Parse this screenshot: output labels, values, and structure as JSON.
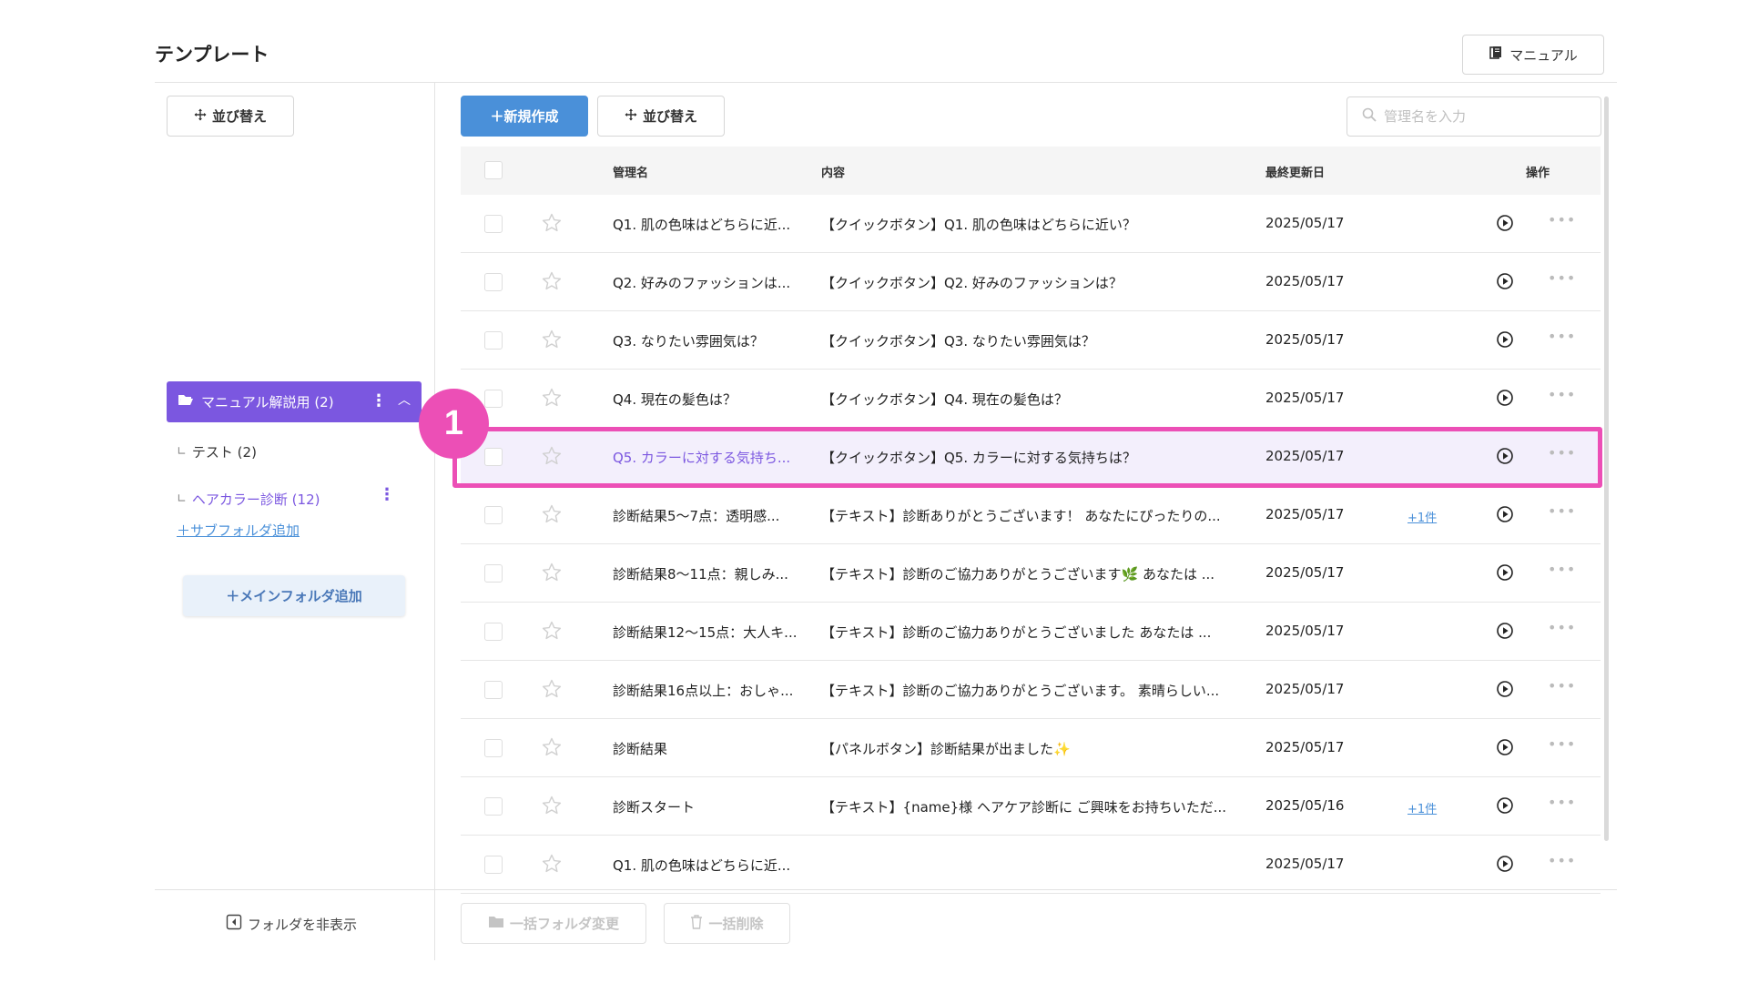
{
  "header": {
    "title": "テンプレート",
    "manual_label": "マニュアル"
  },
  "sidebar": {
    "sort_label": "並び替え",
    "main_folder": {
      "label": "マニュアル解説用 (2)"
    },
    "subfolders": [
      {
        "prefix": "∟",
        "label": "テスト (2)"
      },
      {
        "prefix": "∟",
        "label": "ヘアカラー診断 (12)"
      }
    ],
    "add_subfolder_label": "＋サブフォルダ追加",
    "add_main_folder_label": "＋メインフォルダ追加",
    "hide_folder_label": "フォルダを非表示"
  },
  "toolbar": {
    "new_label": "＋新規作成",
    "sort_label": "並び替え",
    "search_placeholder": "管理名を入力"
  },
  "table": {
    "columns": {
      "name": "管理名",
      "content": "内容",
      "updated": "最終更新日",
      "actions": "操作"
    },
    "rows": [
      {
        "name": "Q1. 肌の色味はどちらに近...",
        "content": "【クイックボタン】Q1. 肌の色味はどちらに近い？",
        "date": "2025/05/17",
        "extra": ""
      },
      {
        "name": "Q2. 好みのファッションは...",
        "content": "【クイックボタン】Q2. 好みのファッションは？",
        "date": "2025/05/17",
        "extra": ""
      },
      {
        "name": "Q3. なりたい雰囲気は？",
        "content": "【クイックボタン】Q3. なりたい雰囲気は？",
        "date": "2025/05/17",
        "extra": ""
      },
      {
        "name": "Q4. 現在の髪色は？",
        "content": "【クイックボタン】Q4. 現在の髪色は？",
        "date": "2025/05/17",
        "extra": ""
      },
      {
        "name": "Q5. カラーに対する気持ち...",
        "content": "【クイックボタン】Q5. カラーに対する気持ちは？",
        "date": "2025/05/17",
        "extra": ""
      },
      {
        "name": "診断結果5〜7点：透明感...",
        "content": "【テキスト】診断ありがとうございます！ あなたにぴったりの...",
        "date": "2025/05/17",
        "extra": "+1件"
      },
      {
        "name": "診断結果8〜11点：親しみ...",
        "content": "【テキスト】診断のご協力ありがとうございます🌿 あなたは ...",
        "date": "2025/05/17",
        "extra": ""
      },
      {
        "name": "診断結果12〜15点：大人キ...",
        "content": "【テキスト】診断のご協力ありがとうございました あなたは ...",
        "date": "2025/05/17",
        "extra": ""
      },
      {
        "name": "診断結果16点以上：おしゃ...",
        "content": "【テキスト】診断のご協力ありがとうございます。 素晴らしい...",
        "date": "2025/05/17",
        "extra": ""
      },
      {
        "name": "診断結果",
        "content": "【パネルボタン】診断結果が出ました✨",
        "date": "2025/05/17",
        "extra": ""
      },
      {
        "name": "診断スタート",
        "content": "【テキスト】{name}様 ヘアケア診断に ご興味をお持ちいただ...",
        "date": "2025/05/16",
        "extra": "+1件"
      },
      {
        "name": "Q1. 肌の色味はどちらに近...",
        "content": "",
        "date": "2025/05/17",
        "extra": ""
      }
    ]
  },
  "footer": {
    "bulk_folder_label": "一括フォルダ変更",
    "bulk_delete_label": "一括削除"
  },
  "annotation": {
    "step_number": "1"
  },
  "colors": {
    "primary": "#4a90d9",
    "folder_active": "#7b57e0",
    "highlight": "#ec4fb6"
  }
}
